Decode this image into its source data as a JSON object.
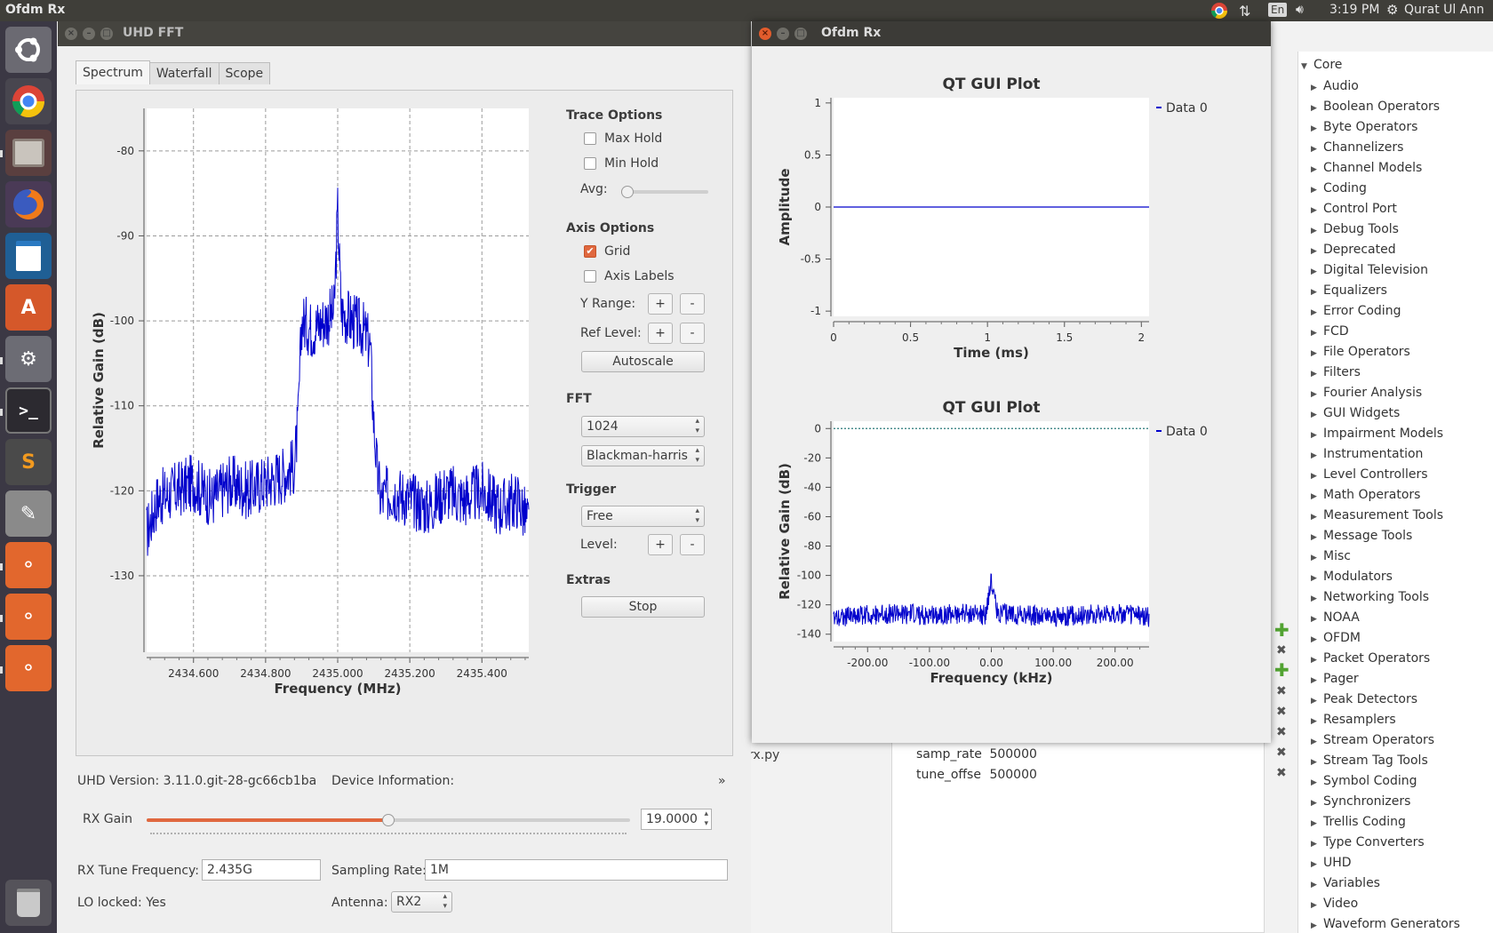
{
  "topbar": {
    "app_name": "Ofdm Rx",
    "lang": "En",
    "time": "3:19 PM",
    "user": "Qurat Ul Ann"
  },
  "launcher": {
    "items": [
      "ubuntu-dash",
      "chrome",
      "files",
      "firefox",
      "writer",
      "software-center",
      "system-settings",
      "terminal",
      "sublime",
      "text-editor",
      "gnuradio-1",
      "gnuradio-2",
      "gnuradio-3",
      "trash"
    ]
  },
  "uhd_window": {
    "title": "UHD FFT",
    "tabs": [
      "Spectrum",
      "Waterfall",
      "Scope"
    ],
    "active_tab": "Spectrum",
    "trace_options": {
      "heading": "Trace Options",
      "max_hold": "Max Hold",
      "min_hold": "Min Hold",
      "avg_label": "Avg:",
      "avg_value": 0.03
    },
    "axis_options": {
      "heading": "Axis Options",
      "grid": "Grid",
      "grid_checked": true,
      "axis_labels": "Axis Labels",
      "y_range": "Y Range:",
      "ref_level": "Ref Level:",
      "plus": "+",
      "minus": "-",
      "autoscale": "Autoscale"
    },
    "fft": {
      "heading": "FFT",
      "size": "1024",
      "window": "Blackman-harris"
    },
    "trigger": {
      "heading": "Trigger",
      "mode": "Free",
      "level_label": "Level:"
    },
    "extras": {
      "heading": "Extras",
      "stop": "Stop"
    },
    "footer": {
      "uhd_version": "UHD Version: 3.11.0.git-28-gc66cb1ba",
      "device_info": "Device Information:",
      "expand": "»",
      "rx_gain_label": "RX Gain",
      "rx_gain_value": "19.0000",
      "rx_gain_fraction": 0.5,
      "rx_tune_label": "RX Tune Frequency:",
      "rx_tune_value": "2.435G",
      "sampling_rate_label": "Sampling Rate:",
      "sampling_rate_value": "1M",
      "lo_locked": "LO locked: Yes",
      "antenna_label": "Antenna:",
      "antenna_value": "RX2"
    }
  },
  "ofdm_window": {
    "title": "Ofdm Rx"
  },
  "chart_data": [
    {
      "type": "line",
      "title": "",
      "xlabel": "Frequency (MHz)",
      "ylabel": "Relative Gain (dB)",
      "xlim": [
        2434.47,
        2435.53
      ],
      "ylim": [
        -139,
        -75
      ],
      "x_ticks": [
        "2434.600",
        "2434.800",
        "2435.000",
        "2435.200",
        "2435.400"
      ],
      "x_tick_values": [
        2434.6,
        2434.8,
        2435.0,
        2435.2,
        2435.4
      ],
      "y_ticks": [
        "-80",
        "-90",
        "-100",
        "-110",
        "-120",
        "-130"
      ],
      "y_tick_values": [
        -80,
        -90,
        -100,
        -110,
        -120,
        -130
      ],
      "grid": true,
      "series": [
        {
          "color": "#0000cc",
          "x": [
            2434.47,
            2434.5,
            2434.55,
            2434.6,
            2434.65,
            2434.7,
            2434.75,
            2434.8,
            2434.85,
            2434.88,
            2434.89,
            2434.9,
            2434.93,
            2434.96,
            2434.99,
            2435.0,
            2435.01,
            2435.04,
            2435.07,
            2435.09,
            2435.1,
            2435.11,
            2435.12,
            2435.15,
            2435.2,
            2435.25,
            2435.3,
            2435.35,
            2435.4,
            2435.45,
            2435.5,
            2435.53
          ],
          "y": [
            -125,
            -121,
            -120,
            -119,
            -121,
            -119,
            -120,
            -119,
            -118,
            -117,
            -112,
            -100,
            -101,
            -100,
            -99,
            -87,
            -99,
            -100,
            -101,
            -103,
            -112,
            -118,
            -121,
            -120,
            -121,
            -122,
            -120,
            -121,
            -120,
            -122,
            -121,
            -124
          ]
        }
      ]
    },
    {
      "type": "line",
      "title": "QT GUI Plot",
      "xlabel": "Time (ms)",
      "ylabel": "Amplitude",
      "xlim": [
        0,
        2.05
      ],
      "ylim": [
        -1.05,
        1.05
      ],
      "x_ticks": [
        "0",
        "0.5",
        "1",
        "1.5",
        "2"
      ],
      "x_tick_values": [
        0,
        0.5,
        1,
        1.5,
        2
      ],
      "y_ticks": [
        "1",
        "0.5",
        "0",
        "-0.5",
        "-1"
      ],
      "y_tick_values": [
        1,
        0.5,
        0,
        -0.5,
        -1
      ],
      "legend": "top-right",
      "series": [
        {
          "name": "Data 0",
          "color": "#0000cc",
          "x": [
            0,
            2.05
          ],
          "y": [
            0,
            0
          ]
        }
      ]
    },
    {
      "type": "line",
      "title": "QT GUI Plot",
      "xlabel": "Frequency (kHz)",
      "ylabel": "Relative Gain (dB)",
      "xlim": [
        -255,
        255
      ],
      "ylim": [
        -145,
        5
      ],
      "x_ticks": [
        "-200.00",
        "-100.00",
        "0.00",
        "100.00",
        "200.00"
      ],
      "x_tick_values": [
        -200,
        -100,
        0,
        100,
        200
      ],
      "y_ticks": [
        "0",
        "-20",
        "-40",
        "-60",
        "-80",
        "-100",
        "-120",
        "-140"
      ],
      "y_tick_values": [
        0,
        -20,
        -40,
        -60,
        -80,
        -100,
        -120,
        -140
      ],
      "legend": "top-right",
      "series": [
        {
          "name": "Data 0",
          "color": "#0000cc",
          "x": [
            -250,
            -200,
            -150,
            -100,
            -50,
            -10,
            0,
            10,
            50,
            100,
            150,
            200,
            250
          ],
          "y": [
            -128,
            -127,
            -126,
            -127,
            -126,
            -127,
            -104,
            -126,
            -127,
            -128,
            -127,
            -126,
            -128
          ]
        },
        {
          "name": "",
          "color": "#2a7a7a",
          "x": [
            -255,
            255
          ],
          "y": [
            0,
            0
          ]
        }
      ]
    }
  ],
  "grc": {
    "file_fragment": "rx.py",
    "variables": [
      {
        "name": "samp_rate",
        "value": "500000"
      },
      {
        "name": "tune_offse",
        "value": "500000"
      }
    ],
    "block_tree_root": "Core",
    "block_tree": [
      "Audio",
      "Boolean Operators",
      "Byte Operators",
      "Channelizers",
      "Channel Models",
      "Coding",
      "Control Port",
      "Debug Tools",
      "Deprecated",
      "Digital Television",
      "Equalizers",
      "Error Coding",
      "FCD",
      "File Operators",
      "Filters",
      "Fourier Analysis",
      "GUI Widgets",
      "Impairment Models",
      "Instrumentation",
      "Level Controllers",
      "Math Operators",
      "Measurement Tools",
      "Message Tools",
      "Misc",
      "Modulators",
      "Networking Tools",
      "NOAA",
      "OFDM",
      "Packet Operators",
      "Pager",
      "Peak Detectors",
      "Resamplers",
      "Stream Operators",
      "Stream Tag Tools",
      "Symbol Coding",
      "Synchronizers",
      "Trellis Coding",
      "Type Converters",
      "UHD",
      "Variables",
      "Video",
      "Waveform Generators"
    ]
  }
}
